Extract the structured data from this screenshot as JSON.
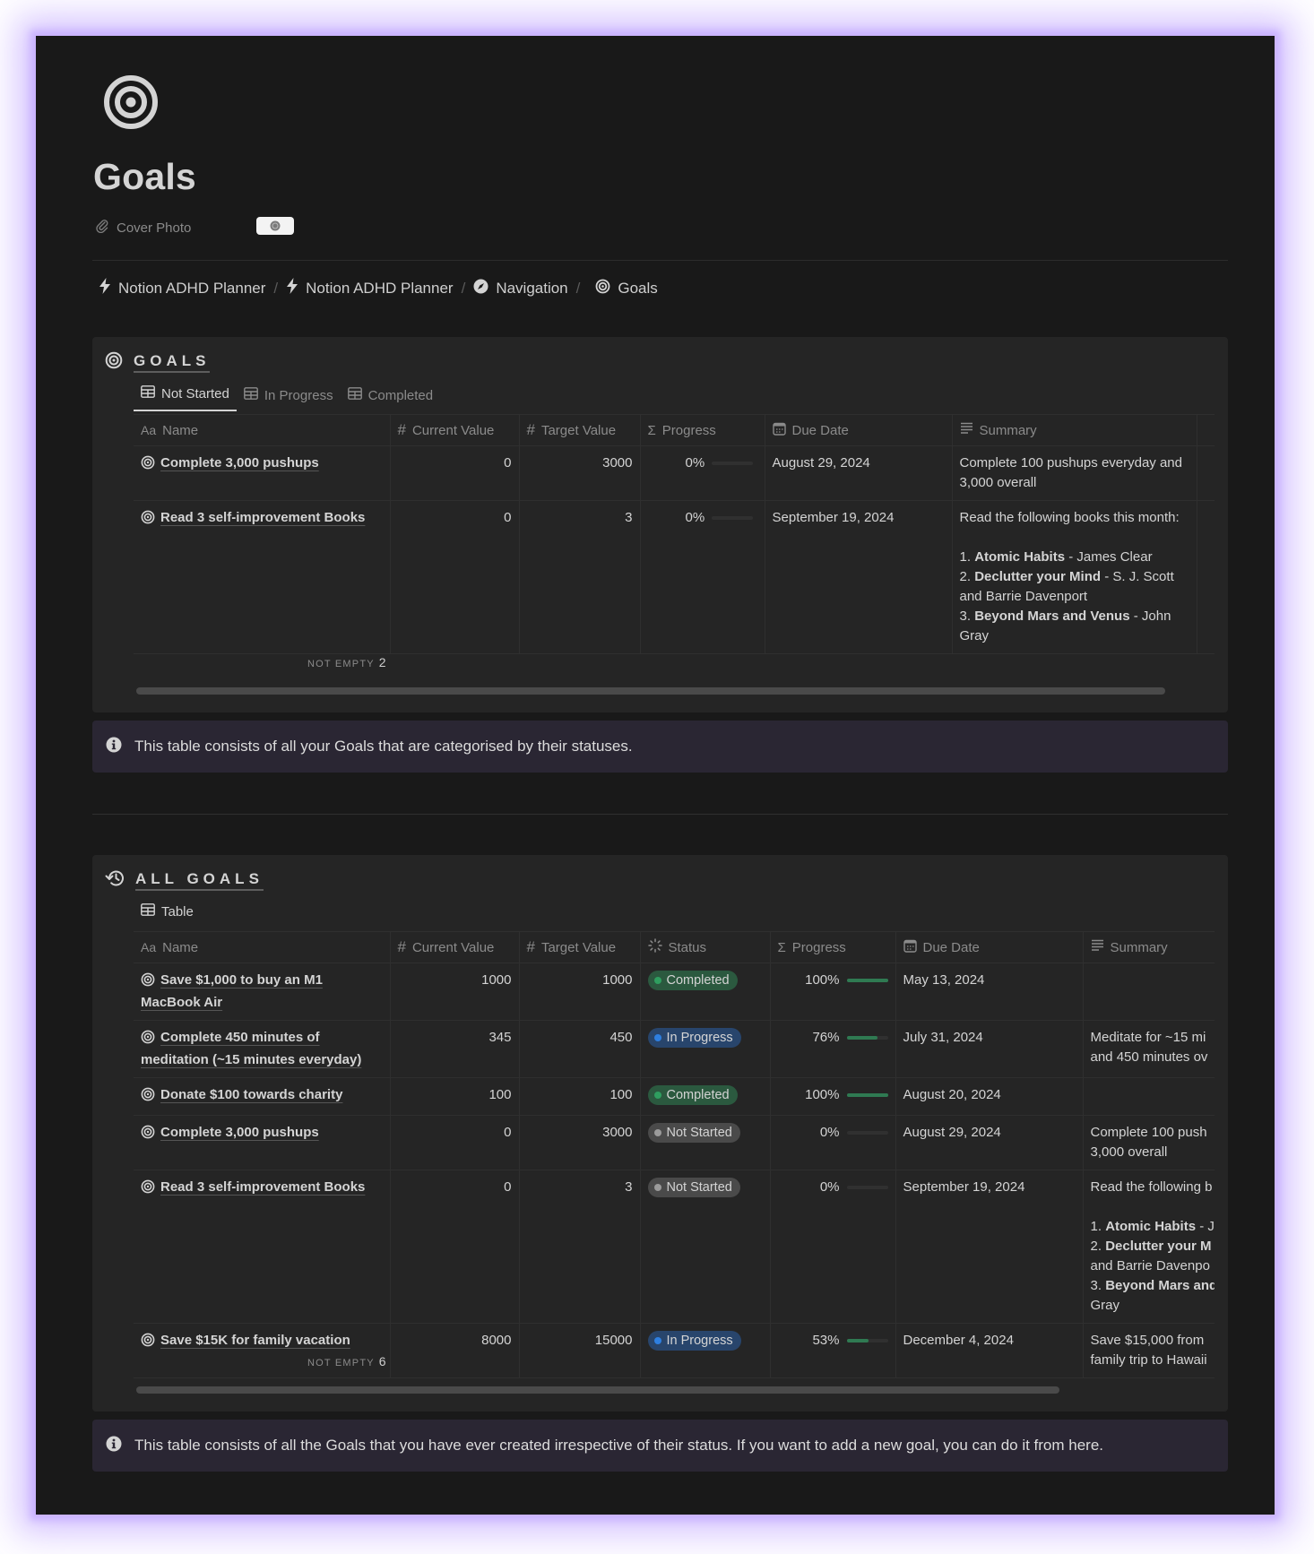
{
  "page": {
    "icon": "target-icon",
    "title": "Goals",
    "properties": [
      {
        "label": "Cover Photo",
        "icon": "paperclip-icon"
      }
    ]
  },
  "breadcrumb": [
    {
      "label": "Notion ADHD Planner",
      "icon": "bolt-icon"
    },
    {
      "label": "Notion ADHD Planner",
      "icon": "bolt-icon"
    },
    {
      "label": "Navigation",
      "icon": "compass-icon"
    },
    {
      "label": "Goals",
      "icon": "target-icon"
    }
  ],
  "colors": {
    "completed_bg": "#2b593f",
    "completed_dot": "#2f9e5f",
    "inprogress_bg": "#28456c",
    "inprogress_dot": "#2e7fe0",
    "notstarted_bg": "#4a4a4a",
    "notstarted_dot": "#9b9b9b",
    "progress_fill": "#2f7a52",
    "callout_bg": "#2a2633"
  },
  "goals_block": {
    "title": "GOALS",
    "tabs": [
      {
        "label": "Not Started",
        "active": true
      },
      {
        "label": "In Progress",
        "active": false
      },
      {
        "label": "Completed",
        "active": false
      }
    ],
    "columns": [
      "Name",
      "Current Value",
      "Target Value",
      "Progress",
      "Due Date",
      "Summary"
    ],
    "column_icons": [
      "Aa",
      "#",
      "#",
      "Σ",
      "calendar-icon",
      "text-lines-icon"
    ],
    "rows": [
      {
        "name": "Complete 3,000 pushups",
        "current": "0",
        "target": "3000",
        "progress_label": "0%",
        "progress": 0,
        "due": "August 29, 2024",
        "summary": [
          "Complete 100 pushups everyday and 3,000 overall"
        ]
      },
      {
        "name": "Read 3 self-improvement Books",
        "current": "0",
        "target": "3",
        "progress_label": "0%",
        "progress": 0,
        "due": "September 19, 2024",
        "summary_intro": "Read the following books this month:",
        "books": [
          {
            "n": "1. ",
            "title": "Atomic Habits",
            "rest": " - James Clear"
          },
          {
            "n": "2. ",
            "title": "Declutter your Mind",
            "rest": " - S. J. Scott and Barrie Davenport"
          },
          {
            "n": "3. ",
            "title": "Beyond Mars and Venus",
            "rest": " - John Gray"
          }
        ]
      }
    ],
    "aggregate_label": "NOT EMPTY",
    "aggregate_value": "2"
  },
  "goals_callout": "This table consists of all your Goals that are categorised by their statuses.",
  "all_goals_block": {
    "title": "ALL GOALS",
    "view": "Table",
    "columns": [
      "Name",
      "Current Value",
      "Target Value",
      "Status",
      "Progress",
      "Due Date",
      "Summary"
    ],
    "rows": [
      {
        "name": "Save $1,000 to buy an M1 MacBook Air",
        "current": "1000",
        "target": "1000",
        "status": "Completed",
        "progress_label": "100%",
        "progress": 1.0,
        "due": "May 13, 2024",
        "summary": []
      },
      {
        "name": "Complete 450 minutes of meditation (~15 minutes everyday)",
        "current": "345",
        "target": "450",
        "status": "In Progress",
        "progress_label": "76%",
        "progress": 0.76,
        "due": "July 31, 2024",
        "summary": [
          "Meditate for ~15 mi",
          "and 450 minutes ov"
        ]
      },
      {
        "name": "Donate $100 towards charity",
        "current": "100",
        "target": "100",
        "status": "Completed",
        "progress_label": "100%",
        "progress": 1.0,
        "due": "August 20, 2024",
        "summary": []
      },
      {
        "name": "Complete 3,000 pushups",
        "current": "0",
        "target": "3000",
        "status": "Not Started",
        "progress_label": "0%",
        "progress": 0,
        "due": "August 29, 2024",
        "summary": [
          "Complete 100 push",
          "3,000 overall"
        ]
      },
      {
        "name": "Read 3 self-improvement Books",
        "current": "0",
        "target": "3",
        "status": "Not Started",
        "progress_label": "0%",
        "progress": 0,
        "due": "September 19, 2024",
        "summary_intro": "Read the following b",
        "books": [
          {
            "n": "1. ",
            "title": "Atomic Habits",
            "rest": " - J"
          },
          {
            "n": "2. ",
            "title": "Declutter your M",
            "rest": ""
          },
          {
            "n": "",
            "title": "",
            "rest": "and Barrie Davenpo"
          },
          {
            "n": "3. ",
            "title": "Beyond Mars and",
            "rest": ""
          },
          {
            "n": "",
            "title": "",
            "rest": "Gray"
          }
        ]
      },
      {
        "name": "Save $15K for family vacation",
        "current": "8000",
        "target": "15000",
        "status": "In Progress",
        "progress_label": "53%",
        "progress": 0.53,
        "due": "December 4, 2024",
        "summary": [
          "Save $15,000 from",
          "family trip to Hawaii"
        ]
      }
    ],
    "aggregate_label": "NOT EMPTY",
    "aggregate_value": "6"
  },
  "all_goals_callout": "This table consists of all the Goals that you have ever created irrespective of their status. If you want to add a new goal, you can do it from here."
}
